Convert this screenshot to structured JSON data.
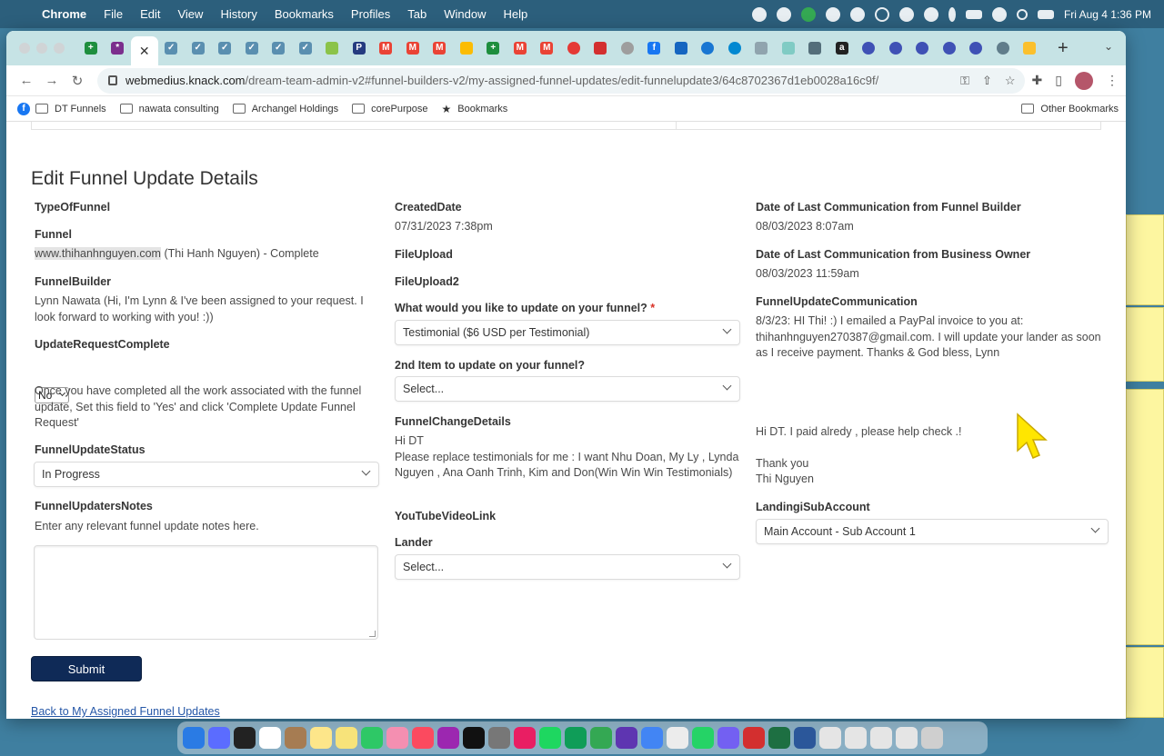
{
  "menubar": {
    "items": [
      "Chrome",
      "File",
      "Edit",
      "View",
      "History",
      "Bookmarks",
      "Profiles",
      "Tab",
      "Window",
      "Help"
    ],
    "datetime": "Fri Aug 4  1:36 PM"
  },
  "browser": {
    "url_host": "webmedius.knack.com",
    "url_path": "/dream-team-admin-v2#funnel-builders-v2/my-assigned-funnel-updates/edit-funnelupdate3/64c8702367d1eb0028a16c9f/",
    "bookmarks": [
      "DT Funnels",
      "nawata consulting",
      "Archangel Holdings",
      "corePurpose",
      "Bookmarks"
    ],
    "other_bookmarks": "Other Bookmarks"
  },
  "form": {
    "title": "Edit Funnel Update Details",
    "col1": {
      "type_label": "TypeOfFunnel",
      "funnel_label": "Funnel",
      "funnel_domain": "www.thihanhnguyen.com",
      "funnel_rest": " (Thi Hanh Nguyen) - Complete",
      "builder_label": "FunnelBuilder",
      "builder_value": "Lynn Nawata (Hi, I'm Lynn & I've been assigned to your request. I look forward to working with you! :))",
      "complete_label": "UpdateRequestComplete",
      "complete_value": "No",
      "complete_help": "Once you have completed all the work associated with the funnel update, Set this field to 'Yes' and click 'Complete Update Funnel Request'",
      "status_label": "FunnelUpdateStatus",
      "status_value": "In Progress",
      "notes_label": "FunnelUpdatersNotes",
      "notes_help": "Enter any relevant funnel update notes here."
    },
    "col2": {
      "created_label": "CreatedDate",
      "created_value": "07/31/2023 7:38pm",
      "fileupload_label": "FileUpload",
      "fileupload2_label": "FileUpload2",
      "update_label": "What would you like to update on your funnel?",
      "required_mark": "*",
      "update_value": "Testimonial ($6 USD per Testimonial)",
      "second_label": "2nd Item to update on your funnel?",
      "second_value": "Select...",
      "change_label": "FunnelChangeDetails",
      "change_line1": "Hi DT",
      "change_line2": "Please replace testimonials for me : I want Nhu Doan, My Ly , Lynda Nguyen , Ana Oanh Trinh, Kim and Don(Win Win Win Testimonials)",
      "youtube_label": "YouTubeVideoLink",
      "lander_label": "Lander",
      "lander_value": "Select..."
    },
    "col3": {
      "lastcomm_builder_label": "Date of Last Communication from Funnel Builder",
      "lastcomm_builder_value": "08/03/2023 8:07am",
      "lastcomm_owner_label": "Date of Last Communication from Business Owner",
      "lastcomm_owner_value": "08/03/2023 11:59am",
      "comm_label": "FunnelUpdateCommunication",
      "comm_value": "8/3/23: HI Thi! :) I emailed a PayPal invoice to you at: thihanhnguyen270387@gmail.com. I will update your lander as soon as I receive payment. Thanks & God bless, Lynn",
      "reply1": "Hi DT. I paid alredy , please help check .!",
      "reply2": "Thank you",
      "reply3": "Thi Nguyen",
      "subaccount_label": "LandingiSubAccount",
      "subaccount_value": "Main Account - Sub Account 1"
    },
    "submit_label": "Submit",
    "back_link": "Back to My Assigned Funnel Updates"
  }
}
